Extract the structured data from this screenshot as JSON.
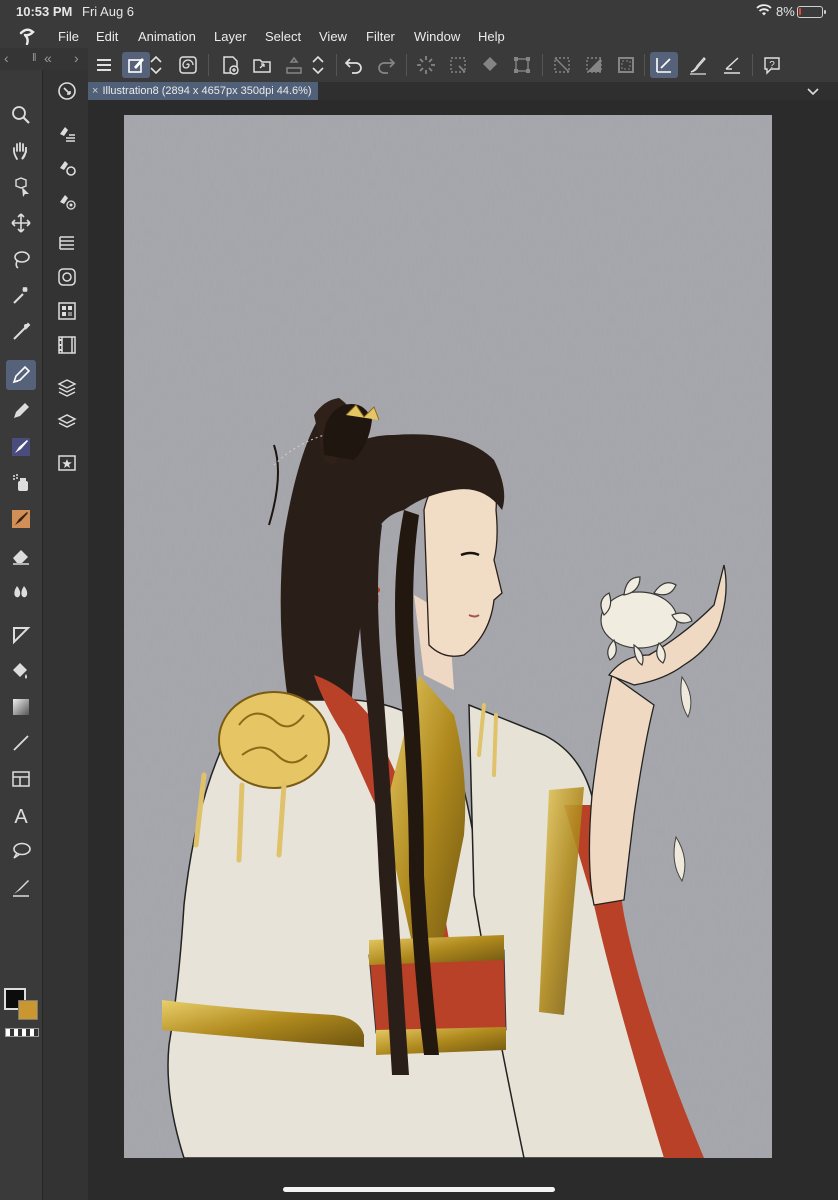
{
  "status_bar": {
    "time": "10:53 PM",
    "date": "Fri Aug 6",
    "battery_percent": "8%",
    "battery_level": 0.08
  },
  "menu": [
    "File",
    "Edit",
    "Animation",
    "Layer",
    "Select",
    "View",
    "Filter",
    "Window",
    "Help"
  ],
  "document_tab": {
    "title": "Illustration8 (2894 x 4657px 350dpi 44.6%)"
  },
  "colors": {
    "main_color": "#0c0c0c",
    "sub_color": "#c9962f",
    "active_tool_bg": "#56627a",
    "canvas_bg": "#a5a6ab"
  },
  "toolbar_icons": [
    "menu-icon",
    "canvas-edit-icon",
    "updown-arrows-icon",
    "spiral-icon",
    "new-file-icon",
    "open-folder-icon",
    "save-icon",
    "updown-arrows-icon",
    "undo-icon",
    "redo-icon",
    "loading-icon",
    "selection-clear-icon",
    "fill-icon",
    "transform-icon",
    "deselect-icon",
    "invert-selection-icon",
    "selection-border-icon",
    "pen-active-icon",
    "brush-icon",
    "ruler-pen-icon",
    "help-icon"
  ],
  "tools": [
    "zoom-tool-icon",
    "hand-tool-icon",
    "object-select-icon",
    "move-tool-icon",
    "lasso-select-icon",
    "magic-wand-icon",
    "eyedropper-icon",
    "pen-tool-icon",
    "pencil-tool-icon",
    "brush-tool-icon",
    "airbrush-icon",
    "decoration-icon",
    "eraser-icon",
    "blend-icon",
    "figure-tool-icon",
    "fill-tool-icon",
    "gradient-icon",
    "line-tool-icon",
    "frame-tool-icon",
    "text-tool-icon",
    "balloon-tool-icon",
    "correct-line-icon"
  ],
  "sub_tools": [
    "navigator-icon",
    "tool-property-icon",
    "sub-tool-detail-icon",
    "brush-size-icon",
    "layer-property-icon",
    "color-wheel-icon",
    "animation-icon",
    "timeline-icon",
    "layer-icon",
    "layer-stack-icon",
    "material-icon"
  ]
}
